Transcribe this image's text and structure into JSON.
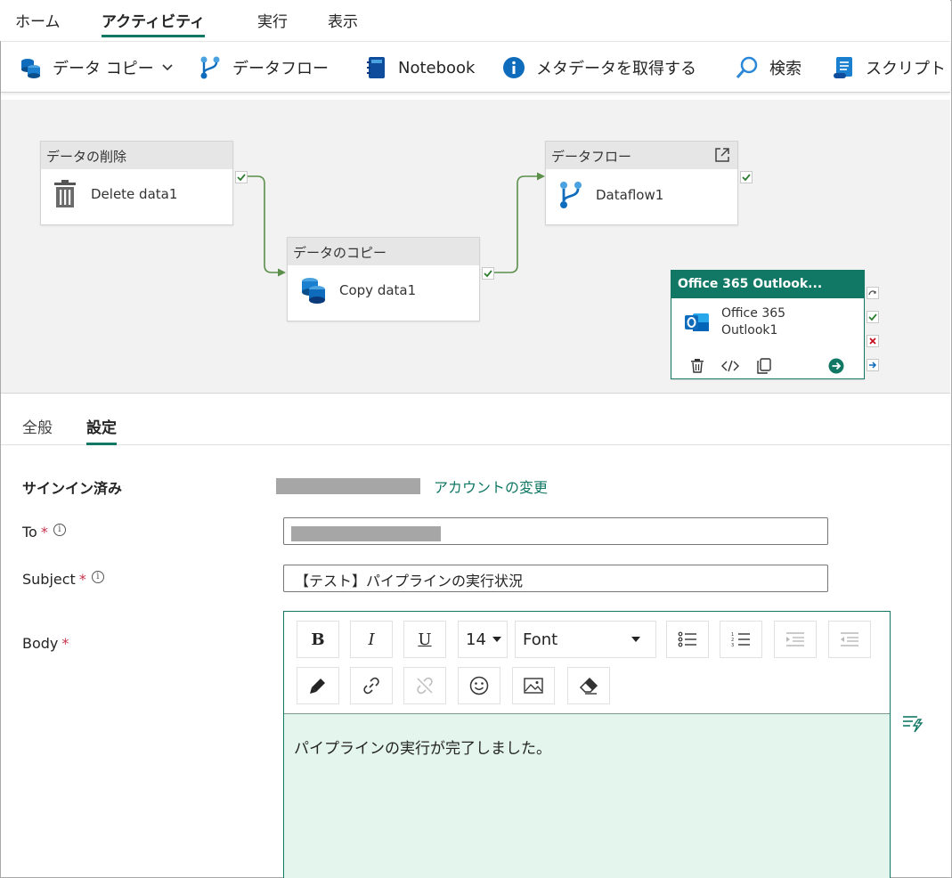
{
  "top_tabs": [
    "ホーム",
    "アクティビティ",
    "実行",
    "表示"
  ],
  "toolbar": {
    "copy_data": "データ コピー",
    "dataflow": "データフロー",
    "notebook": "Notebook",
    "metadata": "メタデータを取得する",
    "search": "検索",
    "script": "スクリプト"
  },
  "canvas": {
    "delete": {
      "head": "データの削除",
      "name": "Delete data1"
    },
    "copy": {
      "head": "データのコピー",
      "name": "Copy data1"
    },
    "dataflow": {
      "head": "データフロー",
      "name": "Dataflow1"
    },
    "outlook": {
      "head": "Office 365 Outlook...",
      "name_line1": "Office 365",
      "name_line2": "Outlook1"
    }
  },
  "panel_tabs": [
    "全般",
    "設定"
  ],
  "settings": {
    "signed_in_label": "サインイン済み",
    "change_account": "アカウントの変更",
    "to_label": "To",
    "subject_label": "Subject",
    "subject_value": "【テスト】パイプラインの実行状況",
    "body_label": "Body",
    "font_size": "14",
    "font_name": "Font",
    "body_text": "パイプラインの実行が完了しました。"
  },
  "colors": {
    "accent": "#117865",
    "editor_bg": "#e3f5ec",
    "outlook_head": "#117865"
  }
}
